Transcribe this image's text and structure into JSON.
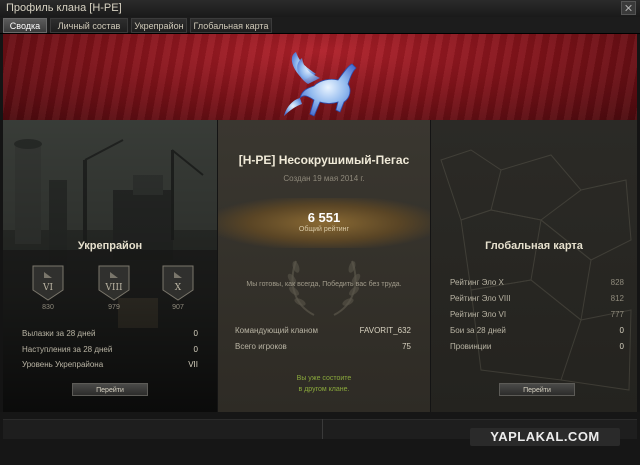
{
  "window": {
    "title": "Профиль клана [Н-РЕ]"
  },
  "tabs": [
    {
      "label": "Сводка",
      "active": true
    },
    {
      "label": "Личный состав",
      "active": false
    },
    {
      "label": "Укрепрайон",
      "active": false
    },
    {
      "label": "Глобальная карта",
      "active": false
    }
  ],
  "clan": {
    "name": "[Н-РЕ] Несокрушимый-Пегас",
    "created": "Создан 19 мая 2014 г.",
    "rating_value": "6 551",
    "rating_label": "Общий рейтинг",
    "motto": "Мы готовы, как всегда, Победить вас без труда.",
    "commander_label": "Командующий кланом",
    "commander_value": "FAVORIT_632",
    "players_label": "Всего игроков",
    "players_value": "75",
    "note_line1": "Вы уже состоите",
    "note_line2": "в другом клане."
  },
  "stronghold": {
    "title": "Укрепрайон",
    "tiers": [
      {
        "label": "VI",
        "value": "830"
      },
      {
        "label": "VIII",
        "value": "979"
      },
      {
        "label": "X",
        "value": "907"
      }
    ],
    "stats": [
      {
        "label": "Вылазки за 28 дней",
        "value": "0"
      },
      {
        "label": "Наступления за 28 дней",
        "value": "0"
      },
      {
        "label": "Уровень Укрепрайона",
        "value": "VII"
      }
    ],
    "button": "Перейти"
  },
  "global_map": {
    "title": "Глобальная карта",
    "stats": [
      {
        "label": "Рейтинг Эло X",
        "value": "828"
      },
      {
        "label": "Рейтинг Эло VIII",
        "value": "812"
      },
      {
        "label": "Рейтинг Эло VI",
        "value": "777"
      },
      {
        "label": "Бои за 28 дней",
        "value": "0"
      },
      {
        "label": "Провинции",
        "value": "0"
      }
    ],
    "button": "Перейти"
  },
  "watermark": "YAPLAKAL.COM",
  "colors": {
    "banner_red": "#9b1a22",
    "accent_green": "#8aa83c",
    "gold": "#8a6a34"
  }
}
